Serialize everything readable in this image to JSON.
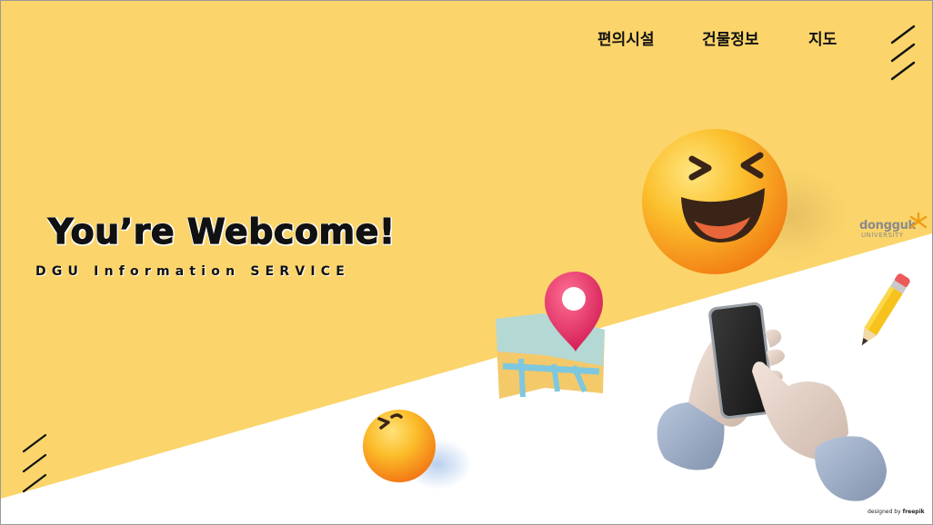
{
  "nav": {
    "items": [
      {
        "label": "편의시설"
      },
      {
        "label": "건물정보"
      },
      {
        "label": "지도"
      }
    ]
  },
  "hero": {
    "title": "You’re Webcome!",
    "subtitle": "DGU Information SERVICE"
  },
  "logo": {
    "name": "dongguk",
    "sub": "UNIVERSITY"
  },
  "credit": {
    "prefix": "designed by",
    "brand": "freepik"
  },
  "icons": {
    "menu": "hamburger-slash-icon",
    "laughing_emoji": "laughing-emoji-icon",
    "winking_emoji": "wink-emoji-icon",
    "map_pin": "map-pin-icon",
    "pencil": "pencil-icon",
    "phone_hands": "hands-holding-phone-icon"
  },
  "colors": {
    "primary_yellow": "#fbd56b",
    "background": "#ffffff",
    "text": "#111111",
    "pin": "#e8366a"
  }
}
